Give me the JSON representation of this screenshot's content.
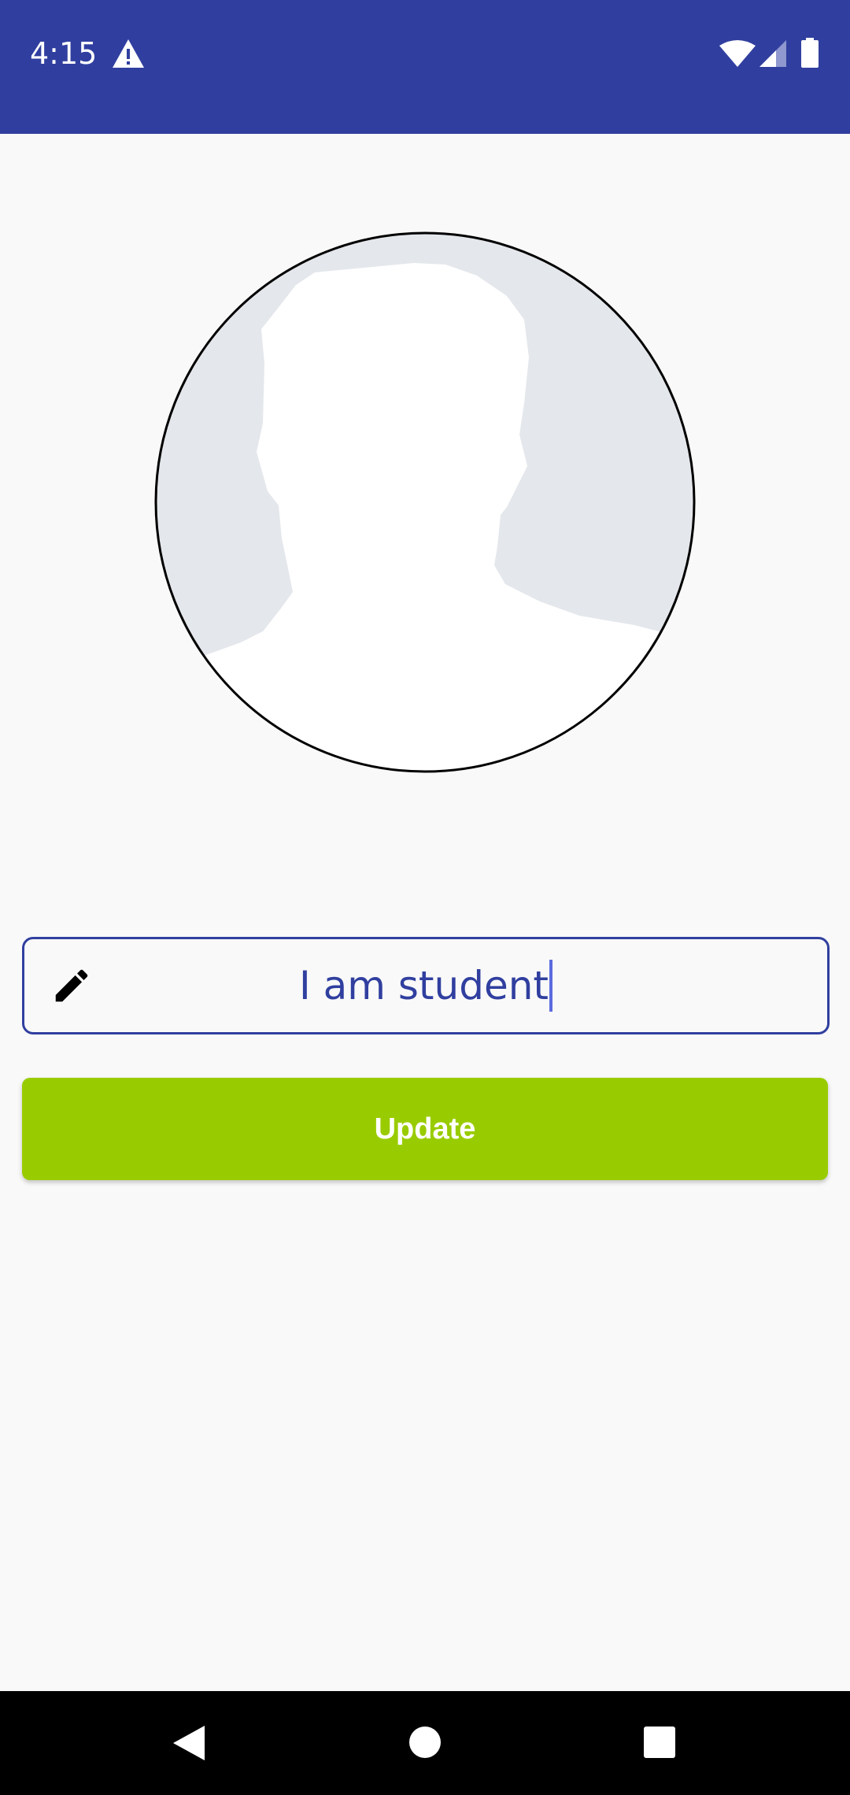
{
  "status_bar": {
    "time": "4:15",
    "background": "#303f9f",
    "icons": [
      "alert-icon",
      "wifi-icon",
      "signal-icon",
      "battery-icon"
    ]
  },
  "profile": {
    "avatar_icon": "default-person-silhouette-icon"
  },
  "status_field": {
    "value": "I am student",
    "icon": "pencil-icon",
    "border_color": "#303f9f",
    "text_color": "#303f9f"
  },
  "update_button": {
    "label": "Update",
    "color": "#99cc00"
  },
  "nav_bar": {
    "icons": [
      "back-icon",
      "home-icon",
      "recents-icon"
    ]
  }
}
